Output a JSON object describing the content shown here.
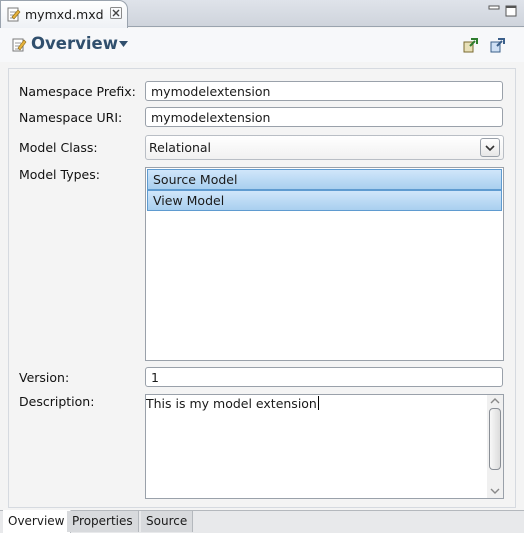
{
  "editor_tab": {
    "title": "mymxd.mxd"
  },
  "header": {
    "title": "Overview"
  },
  "form": {
    "namespace_prefix_label": "Namespace Prefix:",
    "namespace_prefix_value": "mymodelextension",
    "namespace_uri_label": "Namespace URI:",
    "namespace_uri_value": "mymodelextension",
    "model_class_label": "Model Class:",
    "model_class_value": "Relational",
    "model_types_label": "Model Types:",
    "model_types": [
      {
        "label": "Source Model",
        "selected": true
      },
      {
        "label": "View Model",
        "selected": true
      }
    ],
    "version_label": "Version:",
    "version_value": "1",
    "description_label": "Description:",
    "description_value": "This is my model extension"
  },
  "page_tabs": [
    {
      "label": "Overview",
      "active": true
    },
    {
      "label": "Properties",
      "active": false
    },
    {
      "label": "Source",
      "active": false
    }
  ],
  "icons": {
    "file": "mxd-file-icon",
    "close": "close-icon",
    "minimize": "minimize-icon",
    "maximize": "maximize-icon",
    "form": "overview-form-icon",
    "menu": "chevron-down-icon",
    "action1": "import-icon",
    "action2": "export-icon"
  },
  "colors": {
    "title": "#304f6d",
    "selection": "#a9cfef",
    "selection_border": "#5f9bd0"
  }
}
